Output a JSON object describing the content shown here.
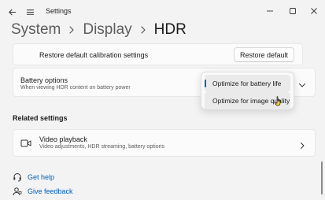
{
  "window": {
    "title": "Settings"
  },
  "breadcrumb": {
    "items": [
      "System",
      "Display",
      "HDR"
    ]
  },
  "calibration": {
    "label": "Restore default calibration settings",
    "button_label": "Restore default"
  },
  "battery": {
    "title": "Battery options",
    "subtitle": "When viewing HDR content on battery power"
  },
  "dropdown": {
    "options": [
      "Optimize for battery life",
      "Optimize for image quality"
    ],
    "selected_index": 0
  },
  "related": {
    "title": "Related settings",
    "video_playback": {
      "title": "Video playback",
      "subtitle": "Video adjustments, HDR streaming, battery options"
    }
  },
  "help": {
    "get_help": "Get help",
    "give_feedback": "Give feedback"
  },
  "colors": {
    "accent": "#005fb8",
    "link": "#005fb8"
  },
  "icons": {
    "back": "back-arrow-icon",
    "menu": "hamburger-menu-icon",
    "minimize": "minimize-icon",
    "maximize": "maximize-icon",
    "close": "close-icon",
    "breadcrumb_separator": "chevron-right-icon",
    "expand": "chevron-down-icon",
    "video": "video-icon",
    "navigate": "chevron-right-icon",
    "help": "help-headset-icon",
    "feedback": "feedback-person-icon",
    "cursor": "mouse-cursor-icon"
  }
}
